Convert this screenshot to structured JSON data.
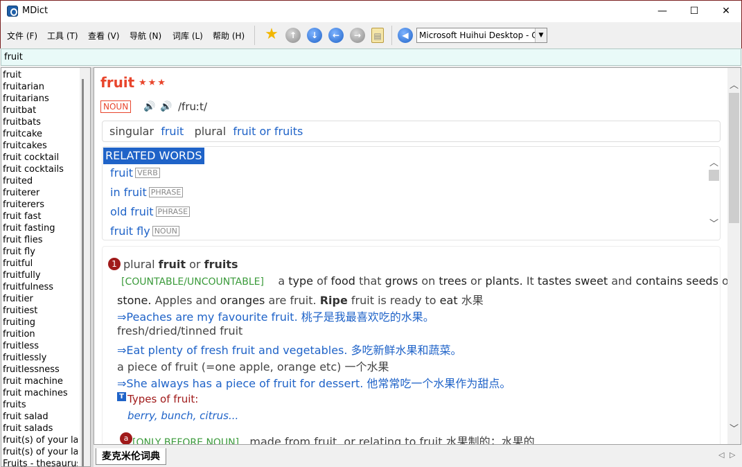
{
  "window": {
    "title": "MDict",
    "minimize": "—",
    "maximize": "☐",
    "close": "✕"
  },
  "menu": [
    "文件 (F)",
    "工具 (T)",
    "查看 (V)",
    "导航 (N)",
    "词库 (L)",
    "帮助 (H)"
  ],
  "toolbar": {
    "dictionary": "Microsoft Huihui Desktop - Chinese (Simplified)",
    "icons": [
      "star-icon",
      "up-icon",
      "down-icon",
      "back-icon",
      "forward-icon",
      "clipboard-icon",
      "speaker-icon"
    ]
  },
  "search": {
    "value": "fruit"
  },
  "wordlist": [
    "fruit",
    "fruitarian",
    "fruitarians",
    "fruitbat",
    "fruitbats",
    "fruitcake",
    "fruitcakes",
    "fruit cocktail",
    "fruit cocktails",
    "fruited",
    "fruiterer",
    "fruiterers",
    "fruit fast",
    "fruit fasting",
    "fruit flies",
    "fruit fly",
    "fruitful",
    "fruitfully",
    "fruitfulness",
    "fruitier",
    "fruitiest",
    "fruiting",
    "fruition",
    "fruitless",
    "fruitlessly",
    "fruitlessness",
    "fruit machine",
    "fruit machines",
    "fruits",
    "fruit salad",
    "fruit salads",
    "fruit(s) of your labour",
    "fruit(s) of your labours",
    "Fruits - thesaurus"
  ],
  "entry": {
    "headword": "fruit",
    "stars": "★★★",
    "pos": "NOUN",
    "phonetic": "/fruːt/",
    "forms": {
      "singular_label": "singular",
      "singular": "fruit",
      "plural_label": "plural",
      "plural": "fruit or fruits"
    },
    "related": {
      "heading": "RELATED WORDS",
      "items": [
        {
          "word": "fruit",
          "tag": "VERB"
        },
        {
          "word": "in fruit",
          "tag": "PHRASE"
        },
        {
          "word": "old fruit",
          "tag": "PHRASE"
        },
        {
          "word": "fruit fly",
          "tag": "NOUN"
        }
      ]
    },
    "sense1": {
      "num": "1",
      "plural_label": "plural",
      "form1": "fruit",
      "or": "or",
      "form2": "fruits",
      "category": "[COUNTABLE/UNCOUNTABLE]",
      "def_a": "a",
      "def_type": "type",
      "def_of": "of",
      "def_food": "food",
      "def_that": "that",
      "def_grows": "grows",
      "def_on": "on",
      "def_trees": "trees",
      "def_or": "or",
      "def_plants": "plants.",
      "def_it": "It",
      "def_tastes": "tastes",
      "def_sweet": "sweet",
      "def_and": "and",
      "def_contains": "contains",
      "def_seeds": "seeds",
      "def_or2": "or a",
      "line2_a": "stone.",
      "line2_b": "Apples and",
      "line2_c": "oranges",
      "line2_d": "are fruit.",
      "line2_e": "Ripe",
      "line2_f": "fruit is ready to",
      "line2_g": "eat",
      "line2_h": "水果",
      "ex1": "⇒Peaches are my favourite fruit. 桃子是我最喜欢吃的水果。",
      "colloc1": "fresh/dried/tinned fruit",
      "ex2": "⇒Eat plenty of fresh fruit and vegetables. 多吃新鲜水果和蔬菜。",
      "colloc2": "a piece of fruit (=one apple, orange etc) 一个水果",
      "ex3": "⇒She always has a piece of fruit for dessert. 他常常吃一个水果作为甜点。",
      "types_label": "Types of fruit:",
      "types": "berry, bunch, citrus...",
      "sub_num": "a",
      "sub_cat": "[ONLY BEFORE NOUN]",
      "sub_def": "made from fruit, or relating to fruit 水果制的；水果的"
    }
  },
  "tabs": {
    "active": "麦克米伦词典"
  },
  "colors": {
    "accent": "#1f63c8",
    "headword": "#e8452c",
    "sense_number": "#a01a1a",
    "category": "#3a9a3a"
  }
}
